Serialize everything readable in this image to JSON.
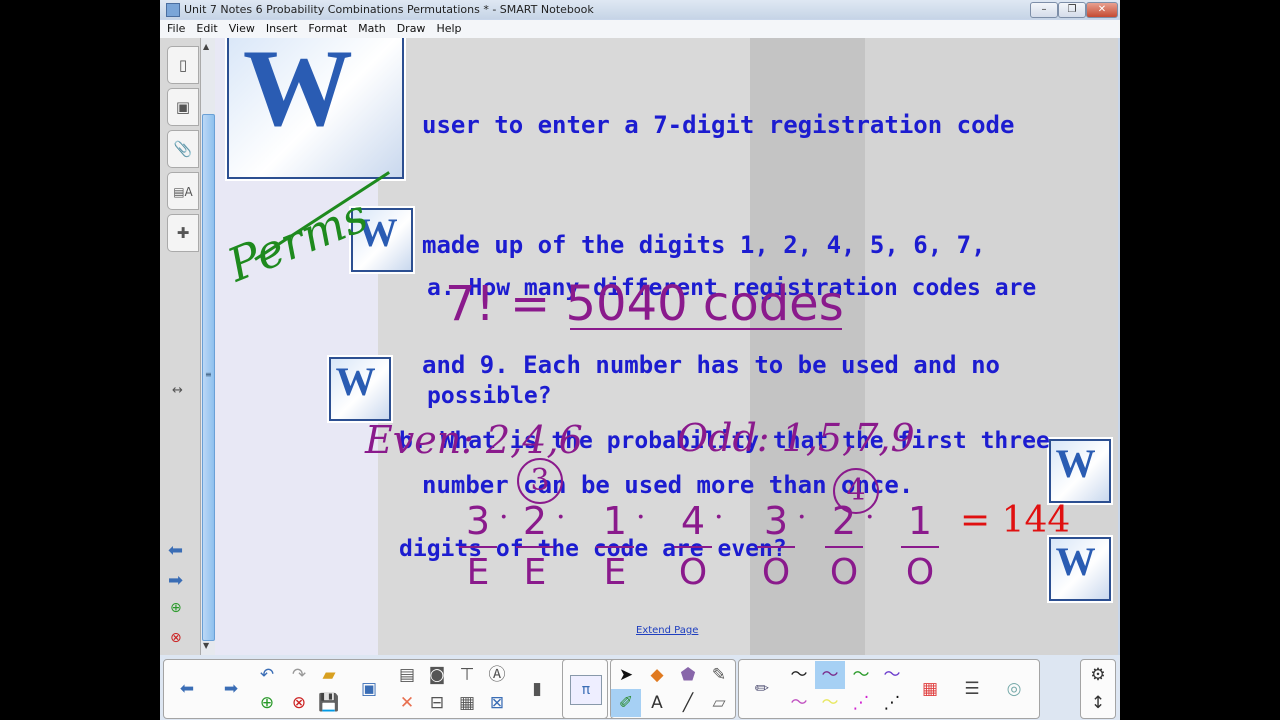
{
  "window": {
    "title": "Unit 7 Notes 6 Probability Combinations Permutations * - SMART Notebook",
    "controls": [
      "minimize",
      "restore",
      "close"
    ]
  },
  "menu": [
    "File",
    "Edit",
    "View",
    "Insert",
    "Format",
    "Math",
    "Draw",
    "Help"
  ],
  "page": {
    "problem_lines": [
      "user to enter a 7-digit registration code",
      "made up of the digits 1, 2, 4, 5, 6, 7,",
      "and 9. Each number has to be used and no",
      "number can be used more than once."
    ],
    "question_a": [
      "a. How many different registration codes are",
      "possible?"
    ],
    "question_b": [
      "b. What is the probability that the first three",
      "digits of the code are even?"
    ],
    "handwriting": {
      "perms": "Perms",
      "answer_a": "7! = 5040 codes",
      "even": "Even: 2,4,6",
      "odd": "Odd: 1,5,7,9",
      "even_count": "3",
      "odd_count": "4",
      "numerators": [
        "3",
        "2",
        "1",
        "4",
        "3",
        "2",
        "1"
      ],
      "denominators": [
        "E",
        "E",
        "E",
        "O",
        "O",
        "O",
        "O"
      ],
      "result": "= 144"
    },
    "colors": {
      "text": "#1c1cd0",
      "ink_purple": "#8a1a8c",
      "ink_green": "#1e8a1e",
      "ink_red": "#e01010"
    },
    "extend_link": "Extend Page"
  },
  "sidebar_tabs": [
    "page-sorter",
    "gallery",
    "attachments",
    "properties",
    "add-ons"
  ],
  "toolbar": {
    "nav": [
      "previous-page",
      "next-page"
    ],
    "edit": [
      "undo",
      "redo",
      "open",
      "add-page",
      "delete-page",
      "save",
      "screen-shade"
    ],
    "insert": [
      "paste",
      "screen-capture",
      "document-camera",
      "handwriting",
      "delete",
      "show-screen",
      "table",
      "full-screen",
      "record"
    ],
    "math": "π",
    "tools": [
      "select",
      "shapes",
      "fill",
      "magic-pen",
      "pens",
      "text",
      "lines",
      "eraser"
    ],
    "pen_styles": [
      "pen",
      "style-1",
      "style-2",
      "style-3",
      "style-4",
      "style-5",
      "style-6",
      "style-7",
      "style-8",
      "colors",
      "line-style",
      "fill-effects"
    ],
    "extra": [
      "settings",
      "move-toolbar"
    ]
  }
}
